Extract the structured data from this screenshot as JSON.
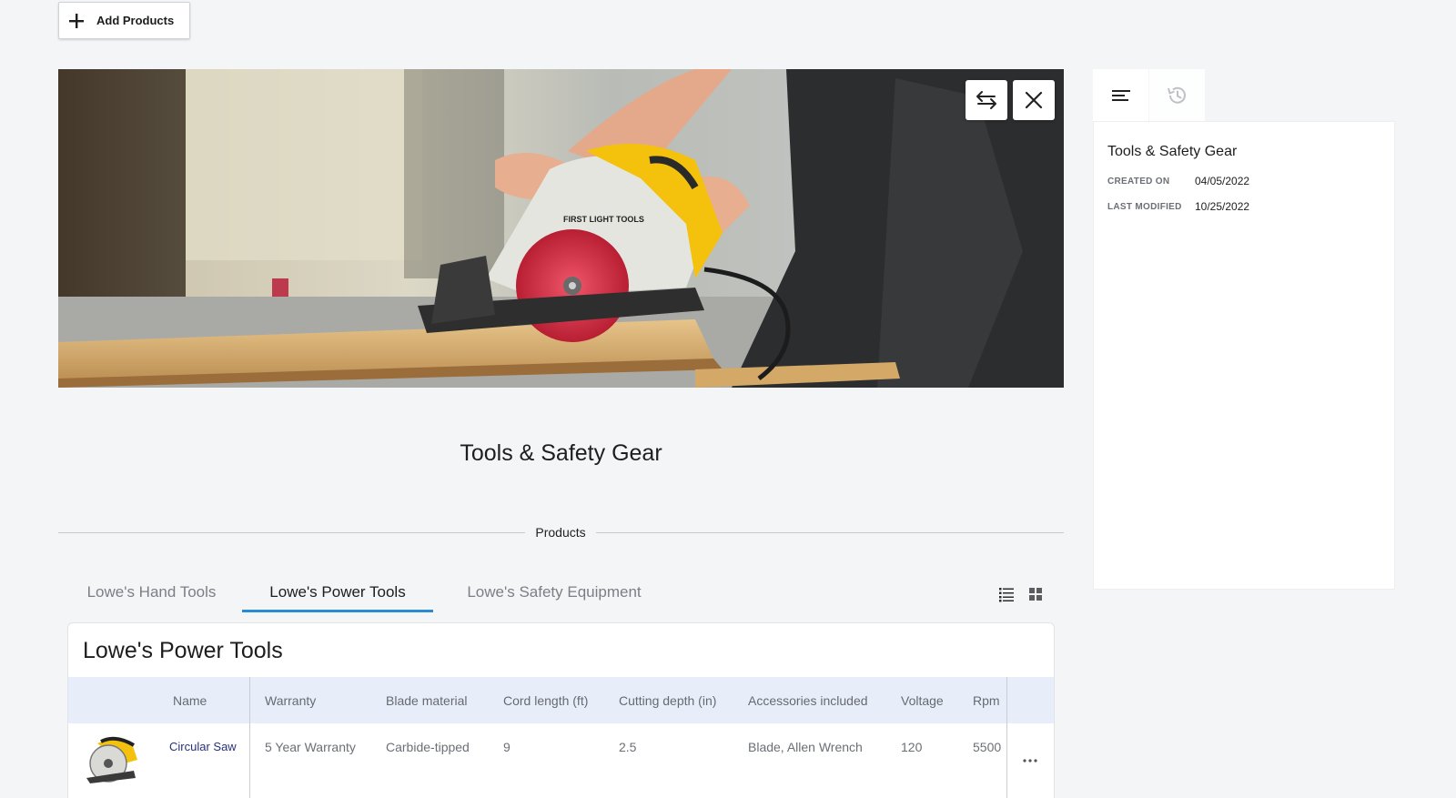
{
  "toolbar": {
    "add_label": "Add Products",
    "add_icon": "plus-icon"
  },
  "hero": {
    "image": "worker-cutting-wood-with-circular-saw",
    "saw_brand": "FIRST LIGHT TOOLS",
    "swap_icon": "swap-arrows-icon",
    "close_icon": "close-icon"
  },
  "page": {
    "title": "Tools & Safety Gear"
  },
  "products_section": {
    "label": "Products"
  },
  "tabs": [
    {
      "label": "Lowe's Hand Tools",
      "active": false
    },
    {
      "label": "Lowe's Power Tools",
      "active": true
    },
    {
      "label": "Lowe's Safety Equipment",
      "active": false
    }
  ],
  "view_toggle": {
    "list_icon": "list-view-icon",
    "grid_icon": "grid-view-icon"
  },
  "table": {
    "title": "Lowe's Power Tools",
    "columns": [
      "Name",
      "Warranty",
      "Blade material",
      "Cord length (ft)",
      "Cutting depth (in)",
      "Accessories included",
      "Voltage",
      "Rpm"
    ],
    "rows": [
      {
        "name": "Circular Saw",
        "warranty": "5 Year Warranty",
        "blade_material": "Carbide-tipped",
        "cord_length": "9",
        "cutting_depth": "2.5",
        "accessories": "Blade, Allen Wrench",
        "voltage": "120",
        "rpm": "5500"
      }
    ]
  },
  "sidebar": {
    "tabs": [
      {
        "icon": "details-lines-icon"
      },
      {
        "icon": "history-clock-icon"
      }
    ],
    "title": "Tools & Safety Gear",
    "created_label": "CREATED ON",
    "created_value": "04/05/2022",
    "modified_label": "LAST MODIFIED",
    "modified_value": "10/25/2022"
  },
  "colors": {
    "accent": "#2a8ad4",
    "background": "#f4f5f7",
    "header_row": "#e8eef9",
    "saw_yellow": "#f4c20d",
    "blade_red": "#d8283c"
  }
}
